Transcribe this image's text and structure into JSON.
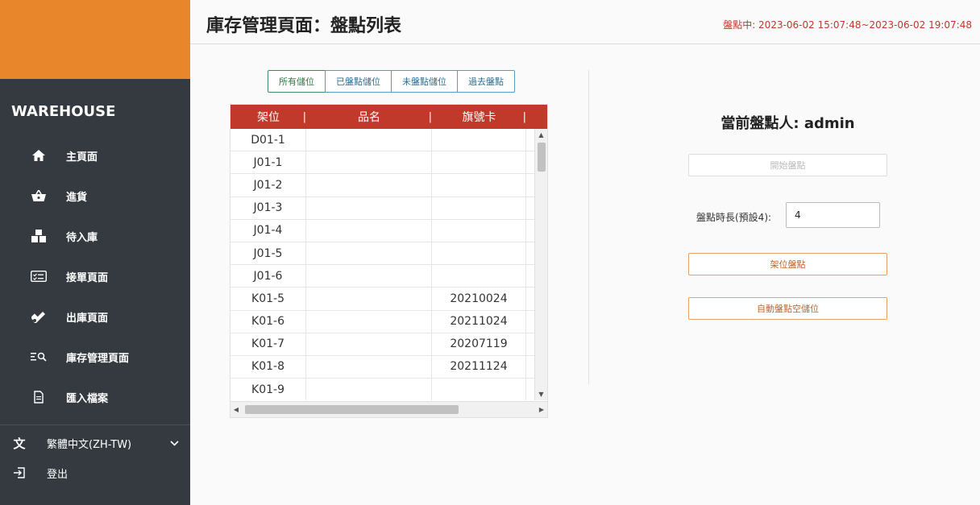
{
  "sidebar": {
    "brand": "WAREHOUSE",
    "items": [
      {
        "label": "主頁面",
        "icon": "home-icon"
      },
      {
        "label": "進貨",
        "icon": "basket-icon"
      },
      {
        "label": "待入庫",
        "icon": "boxes-icon"
      },
      {
        "label": "接單頁面",
        "icon": "checklist-icon"
      },
      {
        "label": "出庫頁面",
        "icon": "dolly-icon"
      },
      {
        "label": "庫存管理頁面",
        "icon": "list-search-icon"
      },
      {
        "label": "匯入檔案",
        "icon": "file-icon"
      }
    ],
    "language": "繁體中文(ZH-TW)",
    "logout": "登出"
  },
  "header": {
    "title": "庫存管理頁面：盤點列表",
    "status": "盤點中: 2023-06-02 15:07:48~2023-06-02 19:07:48"
  },
  "filters": [
    "所有儲位",
    "已盤點儲位",
    "未盤點儲位",
    "過去盤點"
  ],
  "table": {
    "headers": [
      "架位",
      "品名",
      "旗號卡"
    ],
    "rows": [
      [
        "D01-1",
        "",
        ""
      ],
      [
        "J01-1",
        "",
        ""
      ],
      [
        "J01-2",
        "",
        ""
      ],
      [
        "J01-3",
        "",
        ""
      ],
      [
        "J01-4",
        "",
        ""
      ],
      [
        "J01-5",
        "",
        ""
      ],
      [
        "J01-6",
        "",
        ""
      ],
      [
        "K01-5",
        "",
        "20210024"
      ],
      [
        "K01-6",
        "",
        "20211024"
      ],
      [
        "K01-7",
        "",
        "20207119"
      ],
      [
        "K01-8",
        "",
        "20211124"
      ],
      [
        "K01-9",
        "",
        ""
      ]
    ]
  },
  "panel": {
    "counter": "當前盤點人: admin",
    "start_button": "開始盤點",
    "duration_label": "盤點時長(預設4):",
    "duration_value": "4",
    "shelf_button": "架位盤點",
    "auto_button": "自動盤點空儲位"
  },
  "colors": {
    "sidebar": "#343a40",
    "brand_bar": "#e7862b",
    "table_header": "#c0392b",
    "status_text": "#c0392b"
  }
}
